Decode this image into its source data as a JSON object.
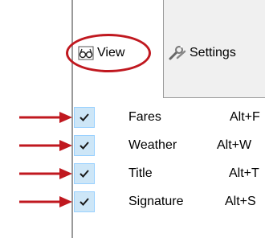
{
  "toolbar": {
    "view_label": "View",
    "settings_label": "Settings"
  },
  "menu": {
    "items": [
      {
        "label": "Fares",
        "shortcut": "Alt+F",
        "checked": true
      },
      {
        "label": "Weather",
        "shortcut": "Alt+W",
        "checked": true
      },
      {
        "label": "Title",
        "shortcut": "Alt+T",
        "checked": true
      },
      {
        "label": "Signature",
        "shortcut": "Alt+S",
        "checked": true
      }
    ]
  },
  "colors": {
    "annotation": "#c0181f",
    "check_bg": "#cde6f7",
    "check_border": "#99d1ff"
  }
}
